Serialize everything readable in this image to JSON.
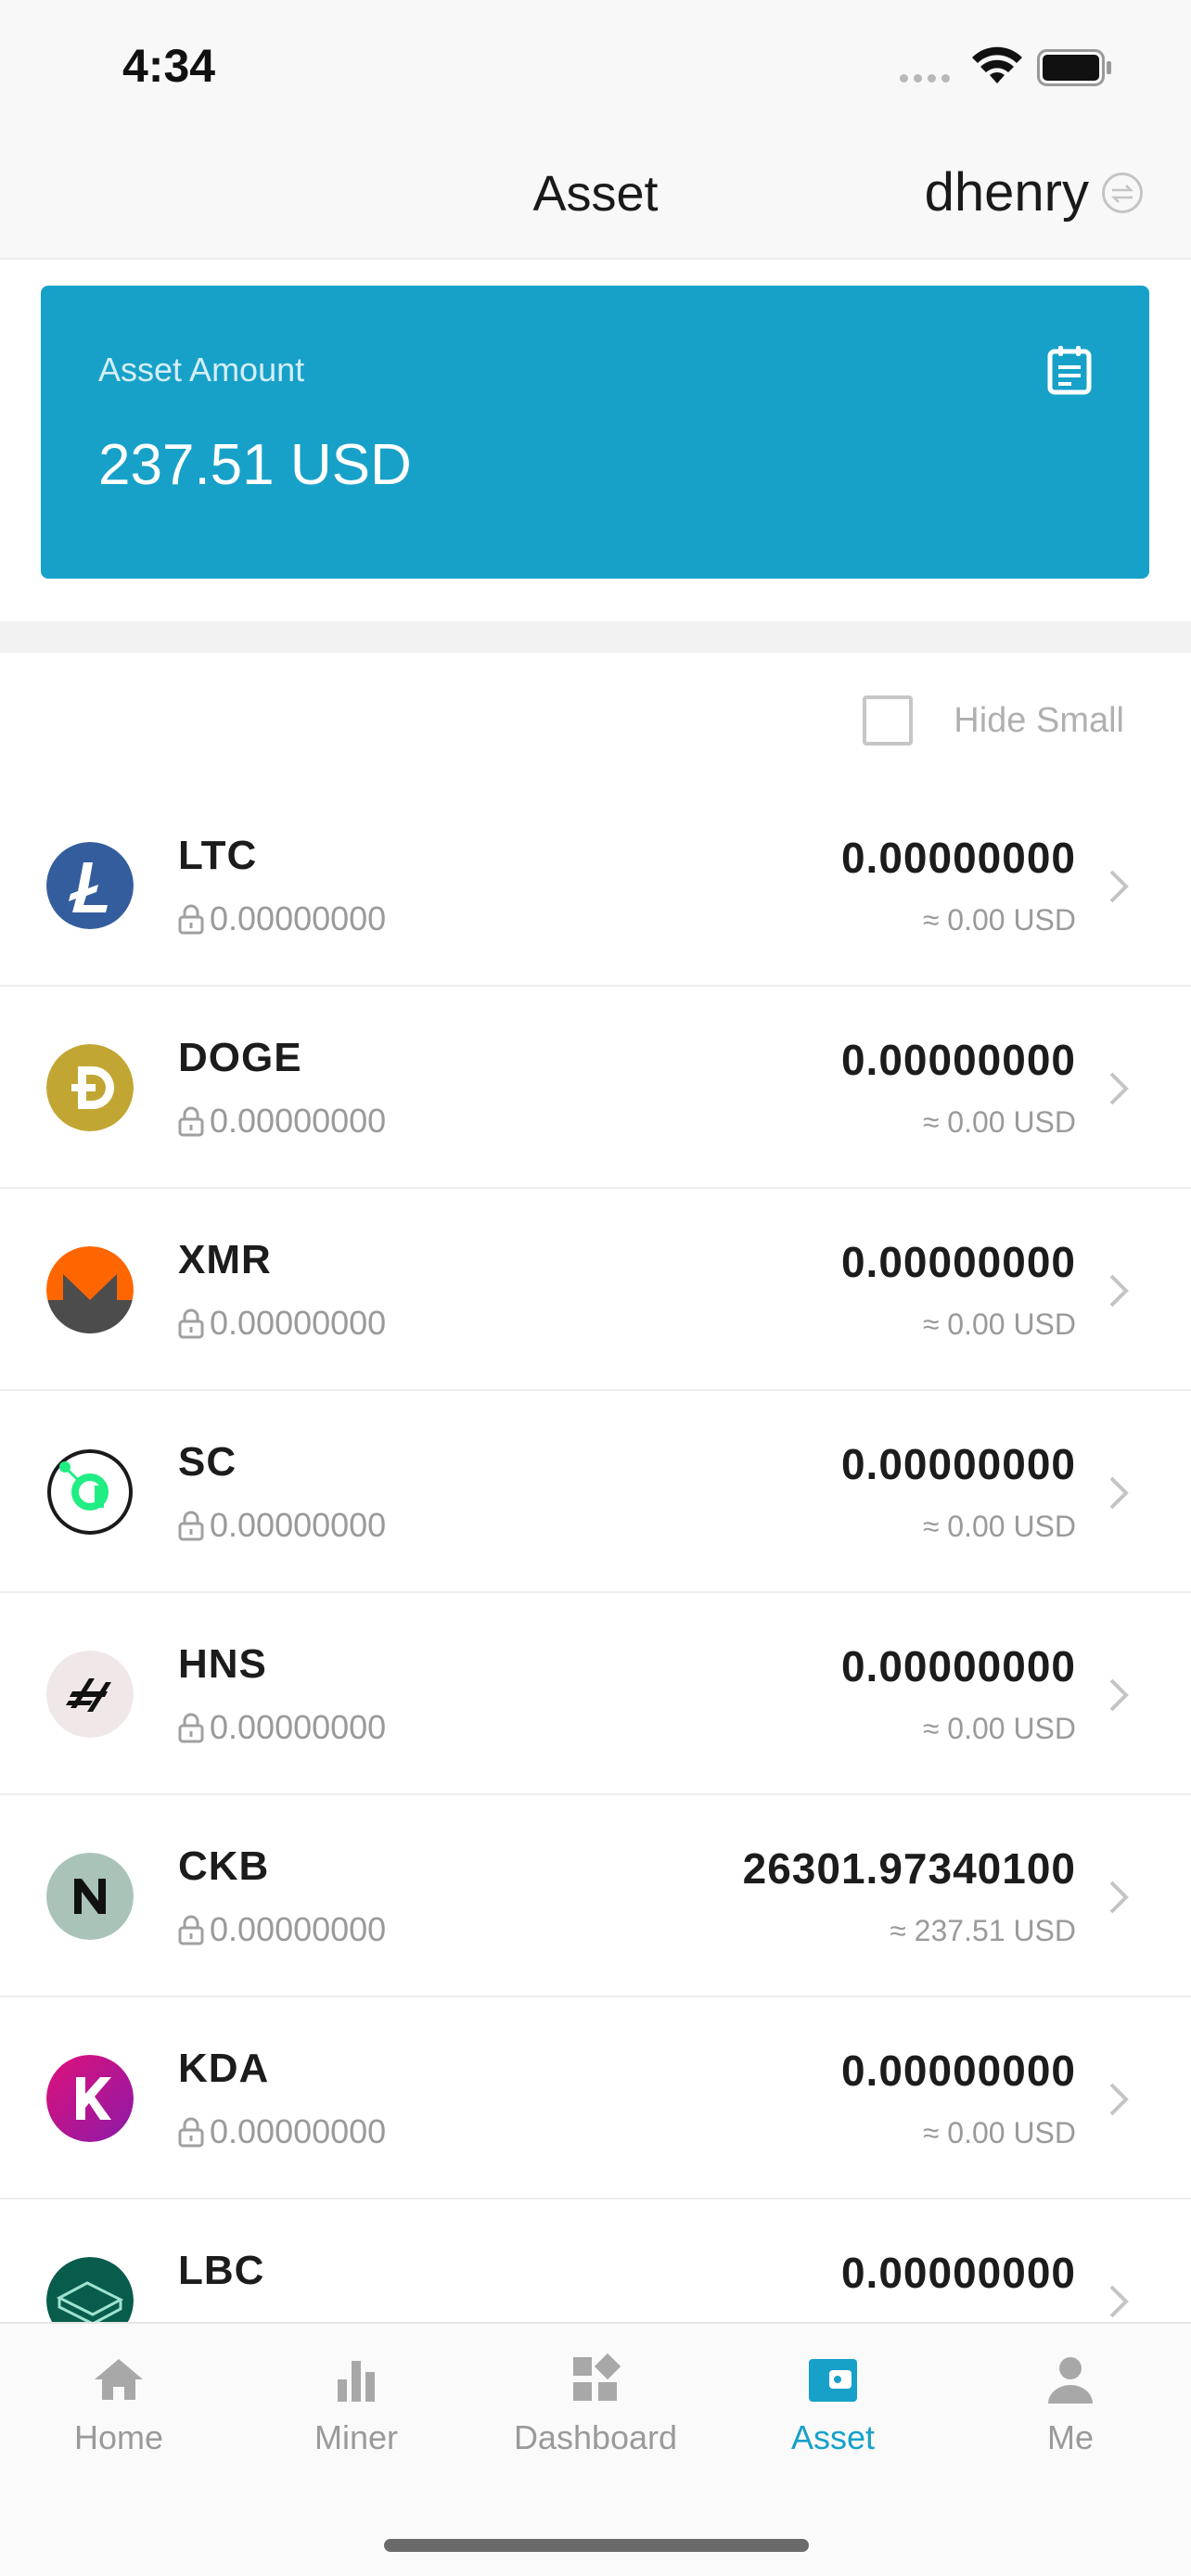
{
  "status_bar": {
    "time": "4:34"
  },
  "nav": {
    "title": "Asset",
    "username": "dhenry"
  },
  "asset_card": {
    "label": "Asset Amount",
    "value": "237.51 USD"
  },
  "filter": {
    "hide_small_label": "Hide Small",
    "hide_small_checked": false
  },
  "coins": [
    {
      "symbol": "LTC",
      "locked": "0.00000000",
      "balance": "0.00000000",
      "usd": "≈ 0.00 USD",
      "logo": "ltc-logo-icon",
      "color": "#345d9d"
    },
    {
      "symbol": "DOGE",
      "locked": "0.00000000",
      "balance": "0.00000000",
      "usd": "≈ 0.00 USD",
      "logo": "doge-logo-icon",
      "color": "#c2a633"
    },
    {
      "symbol": "XMR",
      "locked": "0.00000000",
      "balance": "0.00000000",
      "usd": "≈ 0.00 USD",
      "logo": "xmr-logo-icon",
      "color": "#ff6600"
    },
    {
      "symbol": "SC",
      "locked": "0.00000000",
      "balance": "0.00000000",
      "usd": "≈ 0.00 USD",
      "logo": "sc-logo-icon",
      "color": "#20ee82"
    },
    {
      "symbol": "HNS",
      "locked": "0.00000000",
      "balance": "0.00000000",
      "usd": "≈ 0.00 USD",
      "logo": "hns-logo-icon",
      "color": "#f0e8e8"
    },
    {
      "symbol": "CKB",
      "locked": "0.00000000",
      "balance": "26301.97340100",
      "usd": "≈ 237.51 USD",
      "logo": "ckb-logo-icon",
      "color": "#a9c3b9"
    },
    {
      "symbol": "KDA",
      "locked": "0.00000000",
      "balance": "0.00000000",
      "usd": "≈ 0.00 USD",
      "logo": "kda-logo-icon",
      "color": "#c2158c"
    },
    {
      "symbol": "LBC",
      "locked": "",
      "balance": "0.00000000",
      "usd": "",
      "logo": "lbc-logo-icon",
      "color": "#075c4c"
    }
  ],
  "tabs": [
    {
      "label": "Home",
      "icon": "home-icon",
      "active": false
    },
    {
      "label": "Miner",
      "icon": "bar-chart-icon",
      "active": false
    },
    {
      "label": "Dashboard",
      "icon": "dashboard-icon",
      "active": false
    },
    {
      "label": "Asset",
      "icon": "wallet-icon",
      "active": true
    },
    {
      "label": "Me",
      "icon": "user-icon",
      "active": false
    }
  ],
  "colors": {
    "accent": "#17a1c9",
    "text": "#1c1c1c",
    "muted": "#9a9a9a"
  }
}
